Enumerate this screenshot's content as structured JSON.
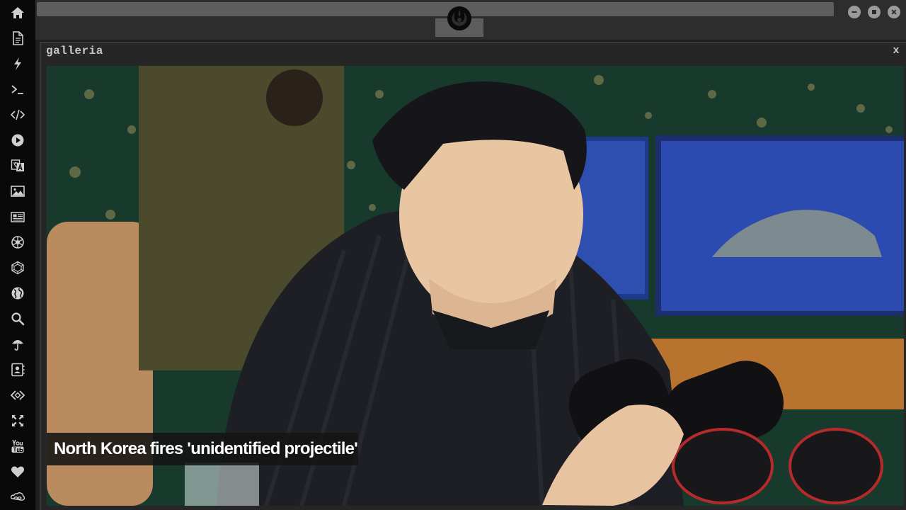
{
  "window": {
    "controls": [
      {
        "name": "minimize",
        "icon": "minus-icon"
      },
      {
        "name": "maximize",
        "icon": "square-icon"
      },
      {
        "name": "close",
        "icon": "x-icon"
      }
    ],
    "logo_icon": "rebel-alliance-icon"
  },
  "sidebar": {
    "items": [
      {
        "icon": "home-icon"
      },
      {
        "icon": "document-icon"
      },
      {
        "icon": "lightning-icon"
      },
      {
        "icon": "terminal-icon"
      },
      {
        "icon": "code-icon"
      },
      {
        "icon": "play-icon"
      },
      {
        "icon": "translate-icon"
      },
      {
        "icon": "image-icon"
      },
      {
        "icon": "newspaper-icon"
      },
      {
        "icon": "aperture-icon"
      },
      {
        "icon": "polyhedron-icon"
      },
      {
        "icon": "globe-icon"
      },
      {
        "icon": "search-icon"
      },
      {
        "icon": "umbrella-icon"
      },
      {
        "icon": "contact-card-icon"
      },
      {
        "icon": "code-diamond-icon"
      },
      {
        "icon": "expand-icon"
      },
      {
        "icon": "youtube-icon"
      },
      {
        "icon": "heart-icon"
      },
      {
        "icon": "infinity-cloud-icon"
      }
    ]
  },
  "panel": {
    "title": "galleria",
    "close_label": "x"
  },
  "gallery": {
    "caption": "North Korea fires 'unidentified projectile'"
  },
  "colors": {
    "sidebar_bg": "#090909",
    "topbar_bg": "#2d2d2d",
    "panel_bg": "#262626",
    "icon": "#cfcfcf",
    "caption_bg": "#141414"
  }
}
